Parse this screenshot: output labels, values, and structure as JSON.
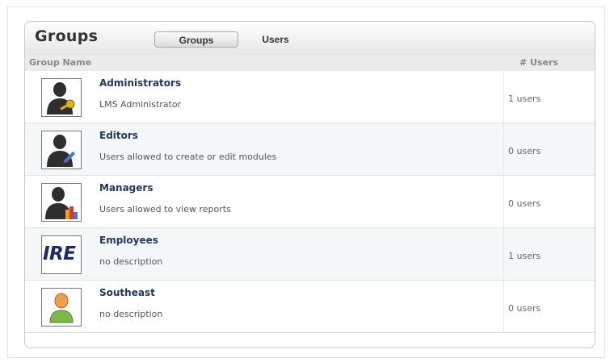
{
  "panel": {
    "title": "Groups"
  },
  "tabs": [
    {
      "label": "Groups",
      "active": true
    },
    {
      "label": "Users",
      "active": false
    }
  ],
  "columns": {
    "name": "Group Name",
    "users": "# Users"
  },
  "groups": [
    {
      "name": "Administrators",
      "description": "LMS Administrator",
      "users": "1 users",
      "icon": "admin-user-icon"
    },
    {
      "name": "Editors",
      "description": "Users allowed to create or edit modules",
      "users": "0 users",
      "icon": "editor-user-icon"
    },
    {
      "name": "Managers",
      "description": "Users allowed to view reports",
      "users": "0 users",
      "icon": "manager-user-icon"
    },
    {
      "name": "Employees",
      "description": "no description",
      "users": "1 users",
      "icon": "ire-logo",
      "logo_text": "IRE"
    },
    {
      "name": "Southeast",
      "description": "no description",
      "users": "0 users",
      "icon": "default-user-icon"
    }
  ]
}
